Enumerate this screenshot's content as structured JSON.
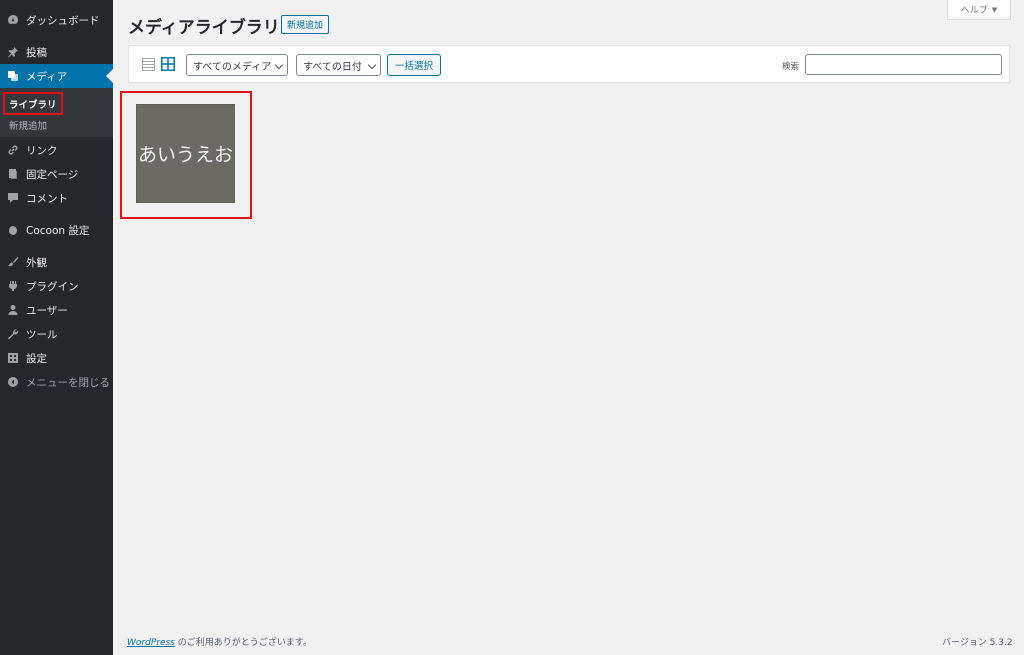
{
  "sidebar": {
    "items": [
      {
        "label": "ダッシュボード",
        "icon": "dashboard-icon"
      },
      {
        "label": "投稿",
        "icon": "pin-icon"
      },
      {
        "label": "メディア",
        "icon": "media-icon"
      },
      {
        "label": "リンク",
        "icon": "link-icon"
      },
      {
        "label": "固定ページ",
        "icon": "page-icon"
      },
      {
        "label": "コメント",
        "icon": "comment-icon"
      },
      {
        "label": "Cocoon 設定",
        "icon": "cocoon-icon"
      },
      {
        "label": "外観",
        "icon": "brush-icon"
      },
      {
        "label": "プラグイン",
        "icon": "plugin-icon"
      },
      {
        "label": "ユーザー",
        "icon": "user-icon"
      },
      {
        "label": "ツール",
        "icon": "wrench-icon"
      },
      {
        "label": "設定",
        "icon": "settings-icon"
      },
      {
        "label": "メニューを閉じる",
        "icon": "collapse-icon"
      }
    ],
    "submenu": {
      "library": "ライブラリ",
      "add_new": "新規追加"
    }
  },
  "header": {
    "title": "メディアライブラリ",
    "add_new": "新規追加",
    "help": "ヘルプ",
    "help_caret": "▼"
  },
  "toolbar": {
    "media_filter": "すべてのメディア",
    "date_filter": "すべての日付",
    "bulk_select": "一括選択",
    "search_label": "検索",
    "search_value": ""
  },
  "attachments": [
    {
      "text": "あいうえお"
    }
  ],
  "footer": {
    "wp_link": "WordPress",
    "thanks": " のご利用ありがとうございます。",
    "version": "バージョン 5.3.2"
  },
  "colors": {
    "sidebar_bg": "#23282d",
    "accent": "#0073aa",
    "highlight_red": "#e0111a",
    "thumbnail_bg": "#6b6b64"
  }
}
